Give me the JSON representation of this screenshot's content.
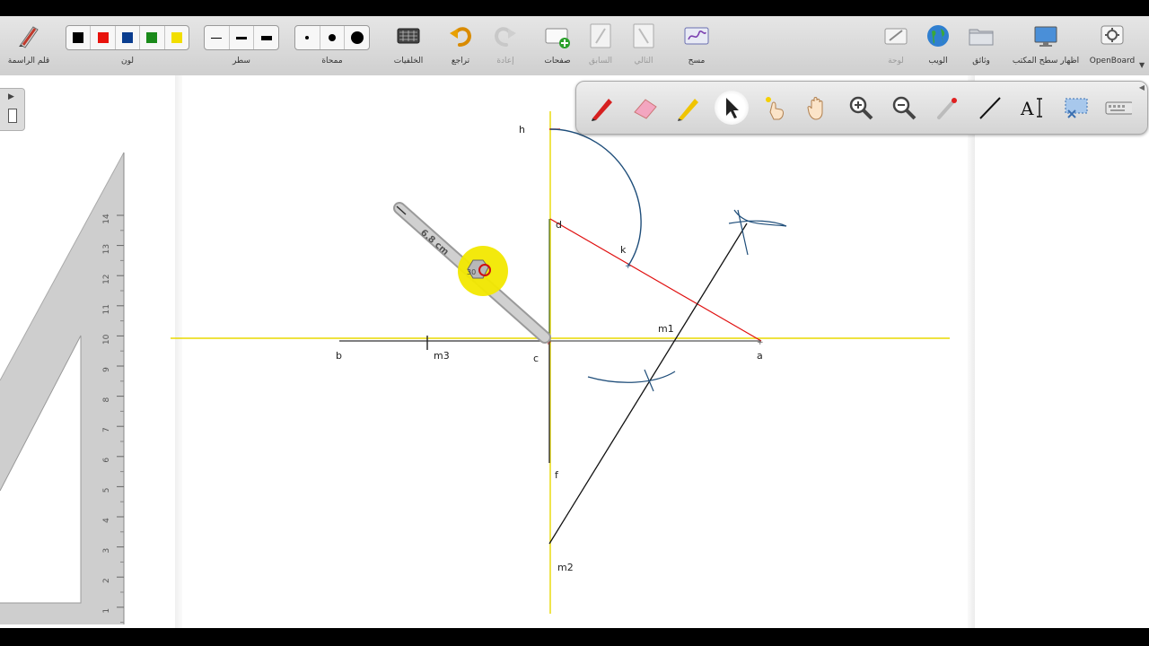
{
  "toolbar": {
    "pen_label": "قلم الراسمة",
    "color_label": "لون",
    "line_label": "سطر",
    "eraser_label": "ممحاة",
    "backgrounds_label": "الخلفيات",
    "undo_label": "تراجع",
    "redo_label": "إعادة",
    "pages_label": "صفحات",
    "previous_label": "السابق",
    "next_label": "التالي",
    "clear_label": "مسح",
    "board_label": "لوحة",
    "web_label": "الويب",
    "documents_label": "وثائق",
    "desktop_label": "اظهار سطح المكتب",
    "openboard_label": "OpenBoard",
    "colors": [
      "#000000",
      "#e8120c",
      "#0a3d8f",
      "#1a8a1a",
      "#f2de00"
    ]
  },
  "floating_tools": [
    {
      "name": "pen-tool-icon",
      "active": false
    },
    {
      "name": "eraser-tool-icon",
      "active": false
    },
    {
      "name": "highlighter-tool-icon",
      "active": false
    },
    {
      "name": "selector-tool-icon",
      "active": true
    },
    {
      "name": "interact-tool-icon",
      "active": false
    },
    {
      "name": "hand-tool-icon",
      "active": false
    },
    {
      "name": "zoom-in-tool-icon",
      "active": false
    },
    {
      "name": "zoom-out-tool-icon",
      "active": false
    },
    {
      "name": "laser-pointer-tool-icon",
      "active": false
    },
    {
      "name": "line-tool-icon",
      "active": false
    },
    {
      "name": "text-tool-icon",
      "active": false
    },
    {
      "name": "capture-tool-icon",
      "active": false
    },
    {
      "name": "keyboard-tool-icon",
      "active": false
    }
  ],
  "drawing": {
    "labels": {
      "h": "h",
      "d": "d",
      "k": "k",
      "m1": "m1",
      "b": "b",
      "m3": "m3",
      "c": "c",
      "a": "a",
      "f": "f",
      "m2": "m2"
    },
    "compass_measure": "6.8 cm",
    "compass_angle": "30"
  },
  "ruler": {
    "ticks": [
      "14",
      "13",
      "12",
      "11",
      "10",
      "9",
      "8",
      "7",
      "6",
      "5",
      "4",
      "3",
      "2",
      "1"
    ]
  }
}
